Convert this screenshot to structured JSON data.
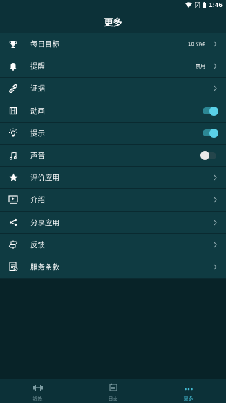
{
  "status_bar": {
    "time": "1:46",
    "icons": [
      "wifi-icon",
      "sim-icon",
      "battery-icon"
    ]
  },
  "header": {
    "title": "更多"
  },
  "menu": {
    "items": [
      {
        "icon": "trophy-icon",
        "label": "每日目标",
        "value": "10 分钟",
        "control": "chevron"
      },
      {
        "icon": "bell-icon",
        "label": "提醒",
        "value": "禁用",
        "control": "chevron"
      },
      {
        "icon": "link-icon",
        "label": "证据",
        "value": "",
        "control": "chevron"
      },
      {
        "icon": "film-icon",
        "label": "动画",
        "control": "toggle",
        "on": true
      },
      {
        "icon": "lightbulb-icon",
        "label": "提示",
        "control": "toggle",
        "on": true
      },
      {
        "icon": "music-note-icon",
        "label": "声音",
        "control": "toggle",
        "on": false
      },
      {
        "icon": "star-icon",
        "label": "评价应用",
        "value": "",
        "control": "chevron"
      },
      {
        "icon": "play-screen-icon",
        "label": "介绍",
        "value": "",
        "control": "chevron"
      },
      {
        "icon": "share-icon",
        "label": "分享应用",
        "value": "",
        "control": "chevron"
      },
      {
        "icon": "signpost-icon",
        "label": "反馈",
        "value": "",
        "control": "chevron"
      },
      {
        "icon": "document-icon",
        "label": "服务条款",
        "value": "",
        "control": "chevron"
      }
    ]
  },
  "bottom_nav": {
    "tabs": [
      {
        "icon": "dumbbell-icon",
        "label": "锻炼",
        "active": false
      },
      {
        "icon": "calendar-icon",
        "label": "日志",
        "active": false
      },
      {
        "icon": "more-dots-icon",
        "label": "更多",
        "active": true
      }
    ]
  },
  "colors": {
    "accent": "#44bcd4",
    "row_bg": "#0f3b42",
    "header_bg": "#0c3138",
    "toggle_on": "#5ad1e8"
  }
}
